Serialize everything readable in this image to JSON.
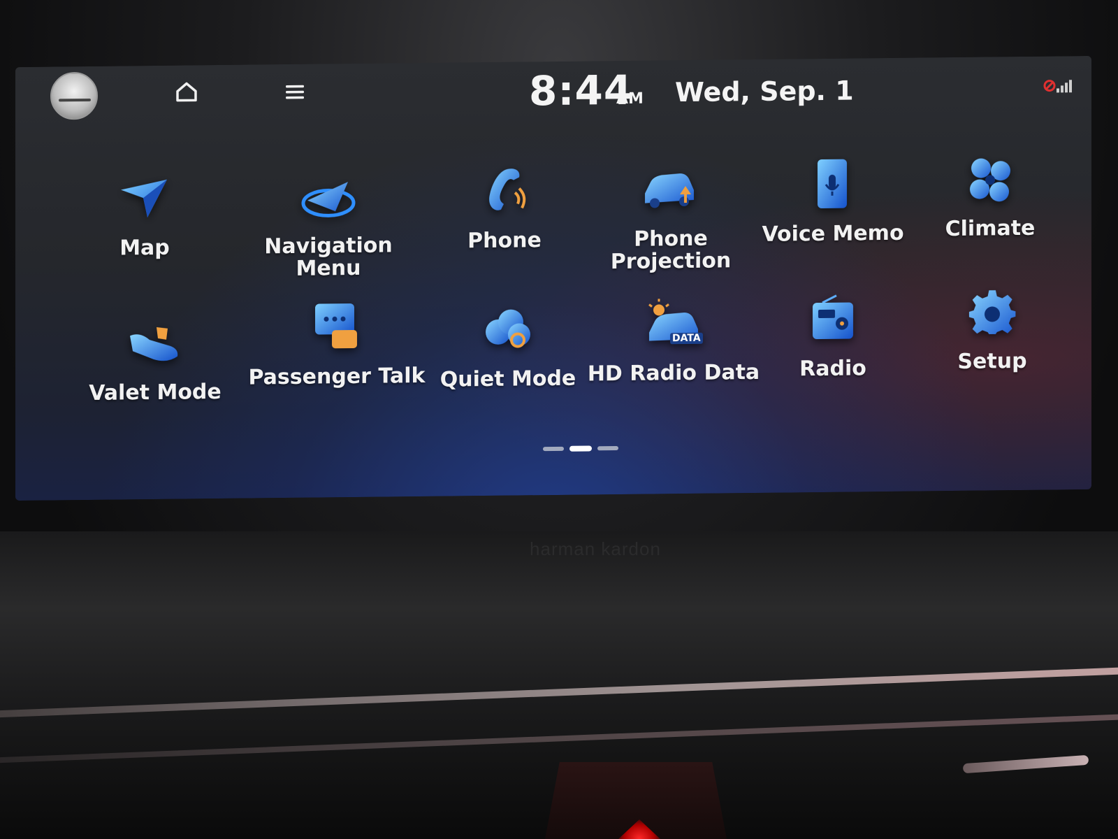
{
  "status": {
    "time": "8:44",
    "ampm": "AM",
    "date": "Wed, Sep. 1"
  },
  "icons": {
    "profile": "profile-avatar-icon",
    "home": "home-icon",
    "menu": "menu-icon",
    "signal": "signal-status-icon"
  },
  "apps": [
    {
      "label": "Map",
      "icon": "map-icon"
    },
    {
      "label": "Navigation Menu",
      "icon": "navigation-menu-icon"
    },
    {
      "label": "Phone",
      "icon": "phone-icon"
    },
    {
      "label": "Phone Projection",
      "icon": "phone-projection-icon"
    },
    {
      "label": "Voice Memo",
      "icon": "voice-memo-icon"
    },
    {
      "label": "Climate",
      "icon": "climate-icon"
    },
    {
      "label": "Valet Mode",
      "icon": "valet-mode-icon"
    },
    {
      "label": "Passenger Talk",
      "icon": "passenger-talk-icon"
    },
    {
      "label": "Quiet Mode",
      "icon": "quiet-mode-icon"
    },
    {
      "label": "HD Radio Data",
      "icon": "hd-radio-data-icon"
    },
    {
      "label": "Radio",
      "icon": "radio-icon"
    },
    {
      "label": "Setup",
      "icon": "setup-icon"
    }
  ],
  "hd_radio_badge": "DATA",
  "pager": {
    "pages": 3,
    "current": 2
  },
  "bezel_brand": "harman kardon",
  "colors": {
    "accent": "#2f8fff",
    "text": "#f2f2f2"
  }
}
